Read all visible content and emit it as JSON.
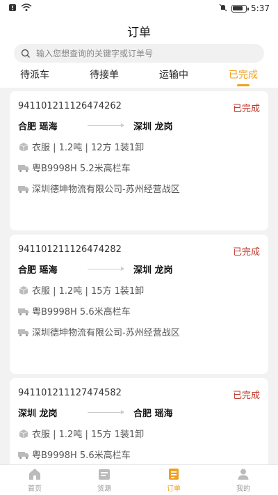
{
  "status_bar": {
    "time": "5:37"
  },
  "header": {
    "title": "订单",
    "search_placeholder": "输入您想查询的关键字或订单号"
  },
  "tabs": [
    {
      "label": "待派车"
    },
    {
      "label": "待接单"
    },
    {
      "label": "运输中"
    },
    {
      "label": "已完成"
    }
  ],
  "orders": [
    {
      "order_no": "941101211126474262",
      "status": "已完成",
      "from": "合肥 瑶海",
      "to": "深圳 龙岗",
      "cargo": "衣服 | 1.2吨 | 12方 1装1卸",
      "vehicle": "粤B9998H 5.2米高栏车",
      "company": "深圳德坤物流有限公司-苏州经营战区"
    },
    {
      "order_no": "941101211126474282",
      "status": "已完成",
      "from": "合肥 瑶海",
      "to": "深圳 龙岗",
      "cargo": "衣服 | 1.2吨 | 15方 1装1卸",
      "vehicle": "粤B9998H 5.6米高栏车",
      "company": "深圳德坤物流有限公司-苏州经营战区"
    },
    {
      "order_no": "941101211127474582",
      "status": "已完成",
      "from": "深圳 龙岗",
      "to": "合肥 瑶海",
      "cargo": "衣服 | 1.2吨 | 15方 1装1卸",
      "vehicle": "粤B9998H 5.6米高栏车"
    }
  ],
  "tabbar": [
    {
      "label": "首页",
      "icon": "home-icon"
    },
    {
      "label": "货源",
      "icon": "cargo-source-icon"
    },
    {
      "label": "订单",
      "icon": "order-icon"
    },
    {
      "label": "我的",
      "icon": "profile-icon"
    }
  ],
  "colors": {
    "accent": "#f0a020",
    "status_done": "#c0392b"
  }
}
